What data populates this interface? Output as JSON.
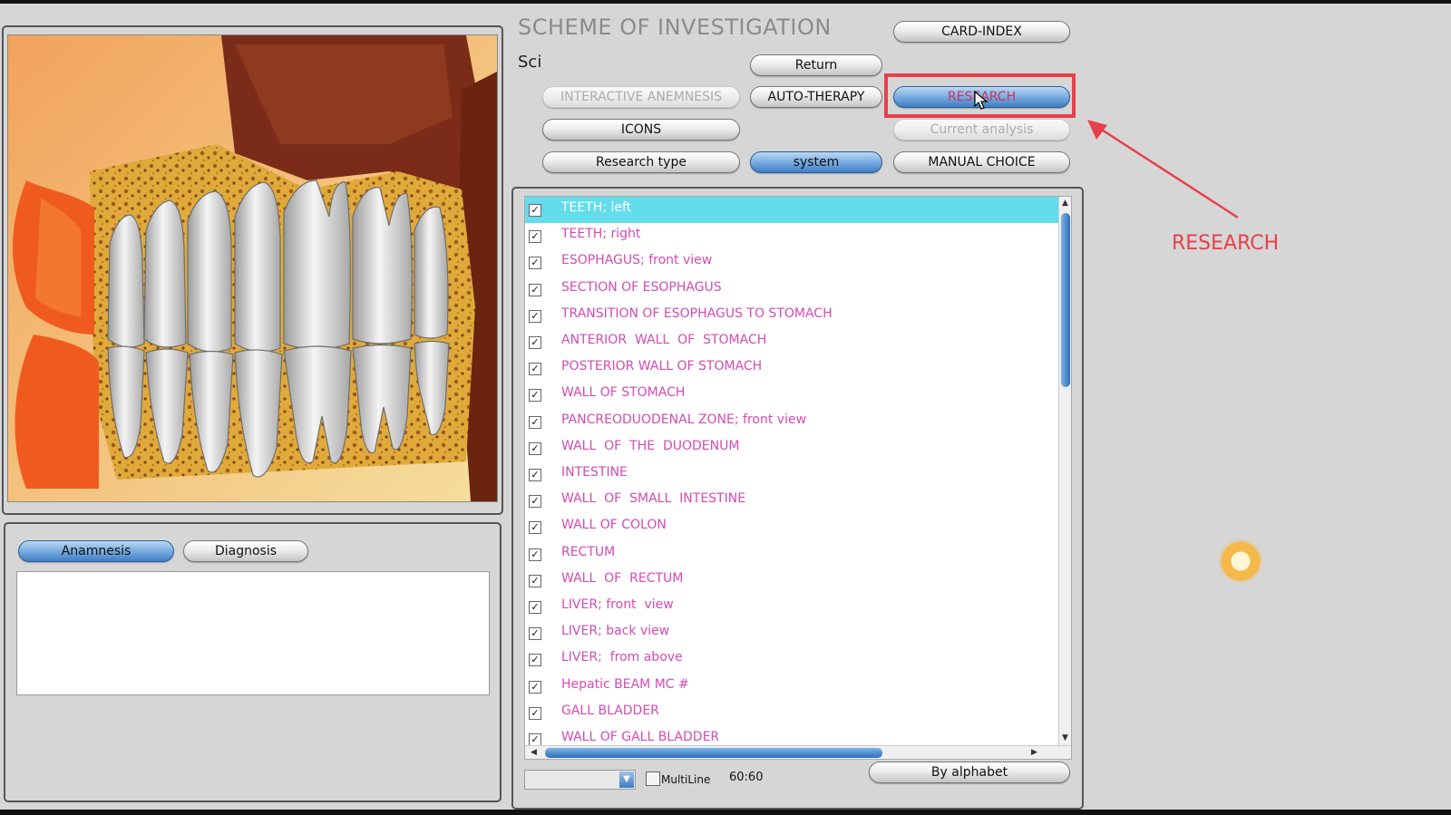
{
  "header": {
    "title": "SCHEME OF INVESTIGATION",
    "subtitle": "Sci"
  },
  "buttons": {
    "card_index": "CARD-INDEX",
    "return": "Return",
    "interactive_anamnesis": "INTERACTIVE ANEMNESIS",
    "auto_therapy": "AUTO-THERAPY",
    "research": "RESEARCH",
    "icons": "ICONS",
    "current_analysis": "Current analysis",
    "research_type": "Research type",
    "system": "system",
    "manual_choice": "MANUAL CHOICE",
    "by_alphabet": "By alphabet"
  },
  "anamnesis_panel": {
    "tabs": [
      "Anamnesis",
      "Diagnosis"
    ],
    "active_tab": "Anamnesis"
  },
  "list": {
    "selected_index": 0,
    "items": [
      "TEETH; left",
      "TEETH; right",
      "ESOPHAGUS; front view",
      "SECTION OF ESOPHAGUS",
      "TRANSITION OF ESOPHAGUS TO STOMACH",
      "ANTERIOR  WALL  OF  STOMACH",
      "POSTERIOR WALL OF STOMACH",
      "WALL OF STOMACH",
      "PANCREODUODENAL ZONE; front view",
      "WALL  OF  THE  DUODENUM",
      "INTESTINE",
      "WALL  OF  SMALL  INTESTINE",
      "WALL OF COLON",
      "RECTUM",
      "WALL  OF  RECTUM",
      "LIVER; front  view",
      "LIVER; back view",
      "LIVER;  from above",
      "Hepatic BEAM MC #",
      "GALL BLADDER",
      "WALL OF GALL BLADDER"
    ]
  },
  "footer": {
    "multiline_label": "MultiLine",
    "time": "60:60"
  },
  "annotation": {
    "label": "RESEARCH",
    "color": "#e8404a"
  },
  "colors": {
    "list_text": "#d24bb4",
    "selection": "#63dcec",
    "accent_blue": "#3e7ec6"
  }
}
